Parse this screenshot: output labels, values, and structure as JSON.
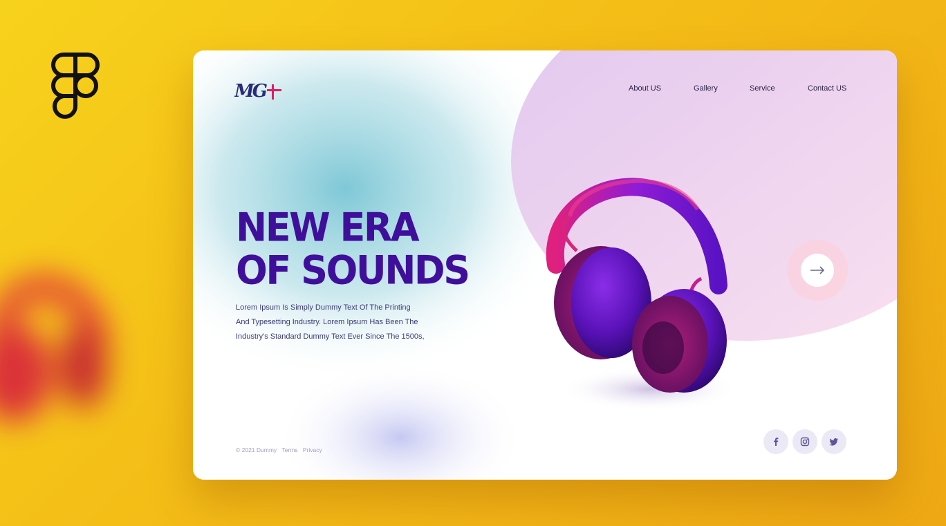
{
  "brand": {
    "logo_text": "MG+",
    "accent": "#e8185f",
    "primary": "#3f0f9b"
  },
  "nav": {
    "items": [
      {
        "label": "About US"
      },
      {
        "label": "Gallery"
      },
      {
        "label": "Service"
      },
      {
        "label": "Contact US"
      }
    ]
  },
  "hero": {
    "headline_line1": "NEW ERA",
    "headline_line2": "OF SOUNDS",
    "body_line1": "Lorem Ipsum Is Simply Dummy Text Of The Printing",
    "body_line2": "And Typesetting Industry. Lorem Ipsum Has Been The",
    "body_line3": "Industry's Standard Dummy Text Ever Since The 1500s,"
  },
  "footer": {
    "copyright": "© 2021 Dummy",
    "terms": "Terms",
    "privacy": "Privacy"
  },
  "controls": {
    "next_icon": "arrow-right-icon"
  },
  "social": {
    "icons": [
      "facebook-icon",
      "instagram-icon",
      "twitter-icon"
    ]
  }
}
